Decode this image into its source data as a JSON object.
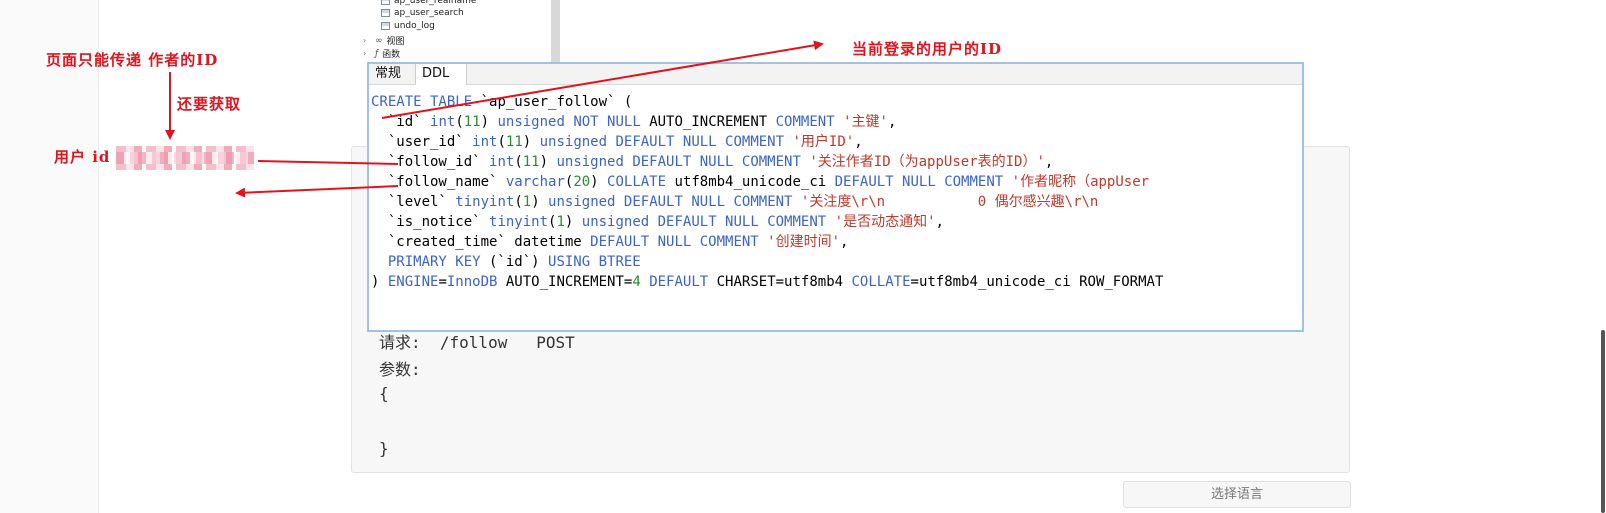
{
  "navigator": {
    "items": [
      {
        "label": "ap_user_realname",
        "type": "table"
      },
      {
        "label": "ap_user_search",
        "type": "table"
      },
      {
        "label": "undo_log",
        "type": "table"
      },
      {
        "label": "视图",
        "type": "folder",
        "icon": "view-icon"
      },
      {
        "label": "函数",
        "type": "folder",
        "icon": "function-icon"
      }
    ]
  },
  "ddl_window": {
    "tabs": [
      {
        "label": "常规",
        "active": false
      },
      {
        "label": "DDL",
        "active": true
      }
    ]
  },
  "doc": {
    "request_line": "请求:  /follow   POST",
    "params_label": "参数:",
    "brace_open": "{",
    "brace_close": "}"
  },
  "language_button": "选择语言",
  "annotations": {
    "current_user_id": "当前登录的用户的ID",
    "only_author_id": "页面只能传递 作者的ID",
    "also_fetch": "还要获取",
    "user_id_prefix": "用户 id"
  },
  "colors": {
    "annotation_red": "#e0141e",
    "sql_keyword": "#3b63c9",
    "sql_number": "#2e8b2e",
    "sql_string": "#c0392b",
    "window_border": "#9fc1ea"
  }
}
